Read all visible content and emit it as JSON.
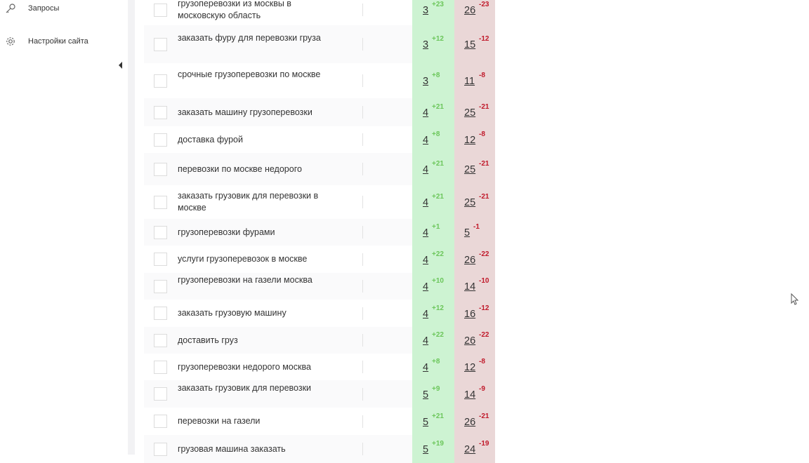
{
  "sidebar": {
    "items": [
      {
        "label": "Запросы",
        "icon": "key-icon"
      },
      {
        "label": "Настройки сайта",
        "icon": "gear-icon"
      }
    ]
  },
  "rows": [
    {
      "keyword": "грузоперевозки из москвы в московскую область",
      "position": "3",
      "position_delta": "+23",
      "competitor": "26",
      "competitor_delta": "-23"
    },
    {
      "keyword": "заказать фуру для перевозки груза",
      "position": "3",
      "position_delta": "+12",
      "competitor": "15",
      "competitor_delta": "-12"
    },
    {
      "keyword": "срочные грузоперевозки по москве",
      "position": "3",
      "position_delta": "+8",
      "competitor": "11",
      "competitor_delta": "-8"
    },
    {
      "keyword": "заказать машину грузоперевозки",
      "position": "4",
      "position_delta": "+21",
      "competitor": "25",
      "competitor_delta": "-21"
    },
    {
      "keyword": "доставка фурой",
      "position": "4",
      "position_delta": "+8",
      "competitor": "12",
      "competitor_delta": "-8"
    },
    {
      "keyword": "перевозки по москве недорого",
      "position": "4",
      "position_delta": "+21",
      "competitor": "25",
      "competitor_delta": "-21"
    },
    {
      "keyword": "заказать грузовик для перевозки в москве",
      "position": "4",
      "position_delta": "+21",
      "competitor": "25",
      "competitor_delta": "-21"
    },
    {
      "keyword": "грузоперевозки фурами",
      "position": "4",
      "position_delta": "+1",
      "competitor": "5",
      "competitor_delta": "-1"
    },
    {
      "keyword": "услуги грузоперевозок в москве",
      "position": "4",
      "position_delta": "+22",
      "competitor": "26",
      "competitor_delta": "-22"
    },
    {
      "keyword": "грузоперевозки на газели москва",
      "position": "4",
      "position_delta": "+10",
      "competitor": "14",
      "competitor_delta": "-10"
    },
    {
      "keyword": "заказать грузовую машину",
      "position": "4",
      "position_delta": "+12",
      "competitor": "16",
      "competitor_delta": "-12"
    },
    {
      "keyword": "доставить груз",
      "position": "4",
      "position_delta": "+22",
      "competitor": "26",
      "competitor_delta": "-22"
    },
    {
      "keyword": "грузоперевозки недорого москва",
      "position": "4",
      "position_delta": "+8",
      "competitor": "12",
      "competitor_delta": "-8"
    },
    {
      "keyword": "заказать грузовик для перевозки",
      "position": "5",
      "position_delta": "+9",
      "competitor": "14",
      "competitor_delta": "-9"
    },
    {
      "keyword": "перевозки на газели",
      "position": "5",
      "position_delta": "+21",
      "competitor": "26",
      "competitor_delta": "-21"
    },
    {
      "keyword": "грузовая машина заказать",
      "position": "5",
      "position_delta": "+19",
      "competitor": "24",
      "competitor_delta": "-19"
    }
  ],
  "colors": {
    "position_bg": "#cdf3d2",
    "competitor_bg": "#ead7d7",
    "delta_up": "#6bc65a",
    "delta_down": "#c0192a"
  }
}
